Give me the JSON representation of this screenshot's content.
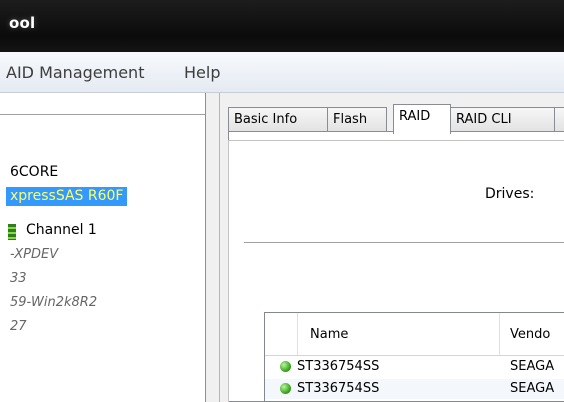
{
  "window": {
    "title": "ool"
  },
  "menubar": {
    "items": [
      "AID Management",
      "Help"
    ]
  },
  "tree": {
    "items": [
      {
        "label": "6CORE",
        "style": "normal"
      },
      {
        "label": "xpressSAS R60F",
        "style": "selected"
      },
      {
        "label": "Channel 1",
        "style": "channel"
      },
      {
        "label": "-XPDEV",
        "style": "italic"
      },
      {
        "label": "33",
        "style": "italic"
      },
      {
        "label": "59-Win2k8R2",
        "style": "italic"
      },
      {
        "label": "27",
        "style": "italic"
      }
    ]
  },
  "tabs": [
    {
      "label": "Basic Info",
      "active": false
    },
    {
      "label": "Flash",
      "active": false
    },
    {
      "label": "RAID",
      "active": true
    },
    {
      "label": "RAID CLI",
      "active": false
    }
  ],
  "raid": {
    "drives_label": "Drives:"
  },
  "drive_table": {
    "columns": [
      "Name",
      "Vendo"
    ],
    "rows": [
      {
        "name": "ST336754SS",
        "vendor": "SEAGA",
        "status": "ok"
      },
      {
        "name": "ST336754SS",
        "vendor": "SEAGA",
        "status": "ok"
      }
    ]
  },
  "colors": {
    "selection_bg": "#3399ff",
    "selection_text": "#ffff66",
    "status_ok": "#3ea81f"
  }
}
